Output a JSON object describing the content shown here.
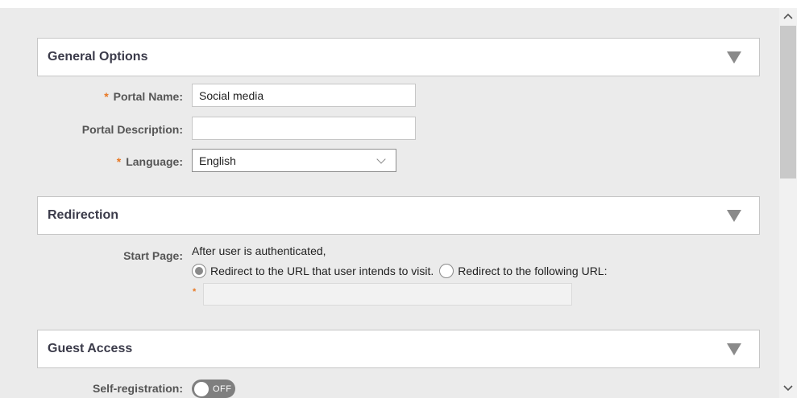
{
  "sections": {
    "general": {
      "title": "General Options"
    },
    "redirection": {
      "title": "Redirection"
    },
    "guest": {
      "title": "Guest Access"
    }
  },
  "fields": {
    "portal_name": {
      "required_mark": "*",
      "label": "Portal Name:",
      "value": "Social media"
    },
    "portal_description": {
      "label": "Portal Description:",
      "value": ""
    },
    "language": {
      "required_mark": "*",
      "label": "Language:",
      "value": "English"
    },
    "start_page": {
      "label": "Start Page:",
      "intro": "After user is authenticated,",
      "option_intended": "Redirect to the URL that user intends to visit.",
      "option_following": "Redirect to the following URL:",
      "selected": "intended",
      "url_required_mark": "*",
      "url_value": ""
    },
    "self_registration": {
      "label": "Self-registration:",
      "state": "OFF"
    }
  },
  "scrollbar": {
    "up_icon": "chevron-up-icon",
    "down_icon": "chevron-down-icon"
  },
  "colors": {
    "required": "#e87722",
    "panel_border": "#c6c6c6",
    "background": "#ebebeb"
  }
}
